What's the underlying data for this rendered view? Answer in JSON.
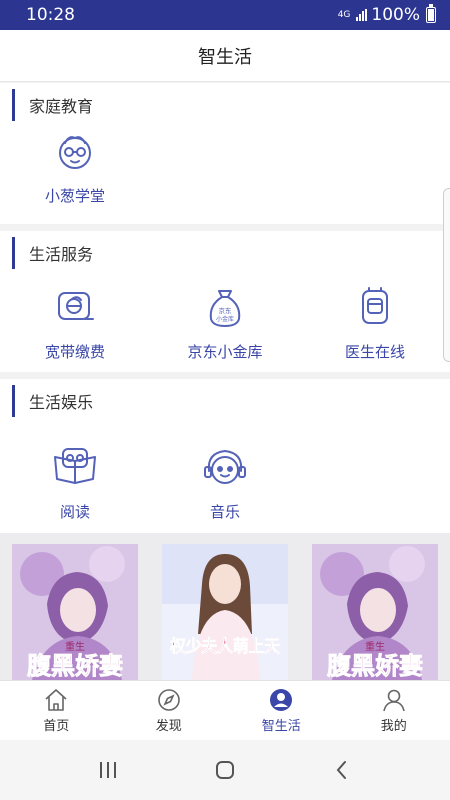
{
  "status": {
    "time": "10:28",
    "network": "4G",
    "battery": "100%"
  },
  "header": {
    "title": "智生活"
  },
  "sections": [
    {
      "title": "家庭教育",
      "items": [
        {
          "label": "小葱学堂",
          "icon": "child-face-icon"
        }
      ]
    },
    {
      "title": "生活服务",
      "items": [
        {
          "label": "宽带缴费",
          "icon": "broadband-icon"
        },
        {
          "label": "京东小金库",
          "icon": "money-bag-icon",
          "icon_text": [
            "京东",
            "小金库"
          ]
        },
        {
          "label": "医生在线",
          "icon": "doctor-icon"
        }
      ]
    },
    {
      "title": "生活娱乐",
      "items": [
        {
          "label": "阅读",
          "icon": "reading-icon"
        },
        {
          "label": "音乐",
          "icon": "music-icon"
        }
      ]
    }
  ],
  "banner": {
    "covers": [
      {
        "title": "腹黑娇妻",
        "tag": "重生"
      },
      {
        "title": "权少夫人萌上天"
      },
      {
        "title": "腹黑娇妻",
        "tag": "重生"
      }
    ]
  },
  "bottom_nav": {
    "active": "智生活",
    "items": [
      {
        "label": "首页",
        "icon": "home-icon"
      },
      {
        "label": "发现",
        "icon": "compass-icon"
      },
      {
        "label": "智生活",
        "icon": "smart-life-icon"
      },
      {
        "label": "我的",
        "icon": "person-icon"
      }
    ]
  },
  "colors": {
    "status_bar": "#2c3590",
    "accent": "#3a46a8",
    "icon": "#5463b8"
  }
}
